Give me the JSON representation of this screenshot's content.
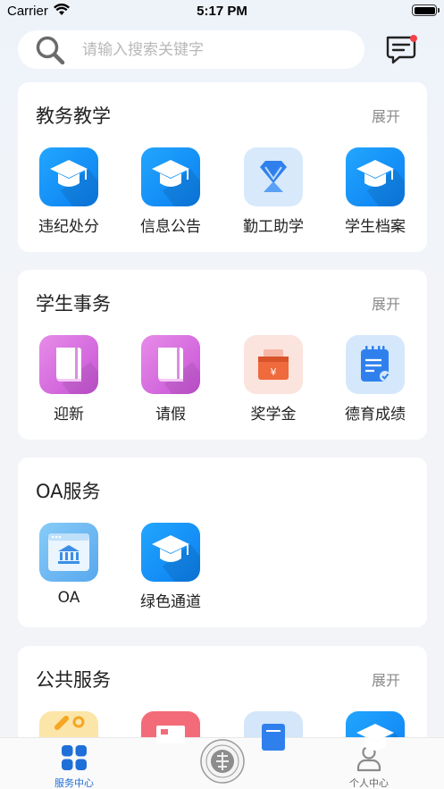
{
  "status_bar": {
    "carrier": "Carrier",
    "time": "5:17 PM"
  },
  "search": {
    "placeholder": "请输入搜索关键字"
  },
  "sections": [
    {
      "title": "教务教学",
      "expand": "展开",
      "items": [
        {
          "label": "违纪处分",
          "icon": "graduation-cap-icon"
        },
        {
          "label": "信息公告",
          "icon": "graduation-cap-icon"
        },
        {
          "label": "勤工助学",
          "icon": "diamond-person-icon"
        },
        {
          "label": "学生档案",
          "icon": "graduation-cap-icon"
        }
      ]
    },
    {
      "title": "学生事务",
      "expand": "展开",
      "items": [
        {
          "label": "迎新",
          "icon": "book-icon"
        },
        {
          "label": "请假",
          "icon": "book-icon"
        },
        {
          "label": "奖学金",
          "icon": "money-box-icon"
        },
        {
          "label": "德育成绩",
          "icon": "clipboard-check-icon"
        }
      ]
    },
    {
      "title": "OA服务",
      "items": [
        {
          "label": "OA",
          "icon": "bank-window-icon"
        },
        {
          "label": "绿色通道",
          "icon": "graduation-cap-icon"
        }
      ]
    },
    {
      "title": "公共服务",
      "expand": "展开"
    }
  ],
  "tabs": [
    {
      "label": "服务中心",
      "icon": "grid-icon",
      "active": true
    },
    {
      "label": "个人中心",
      "icon": "person-icon",
      "active": false
    }
  ],
  "colors": {
    "accent": "#1f6fd9",
    "tab_inactive": "#888888",
    "card_bg": "#ffffff",
    "expand_text": "#8a8a8a"
  }
}
